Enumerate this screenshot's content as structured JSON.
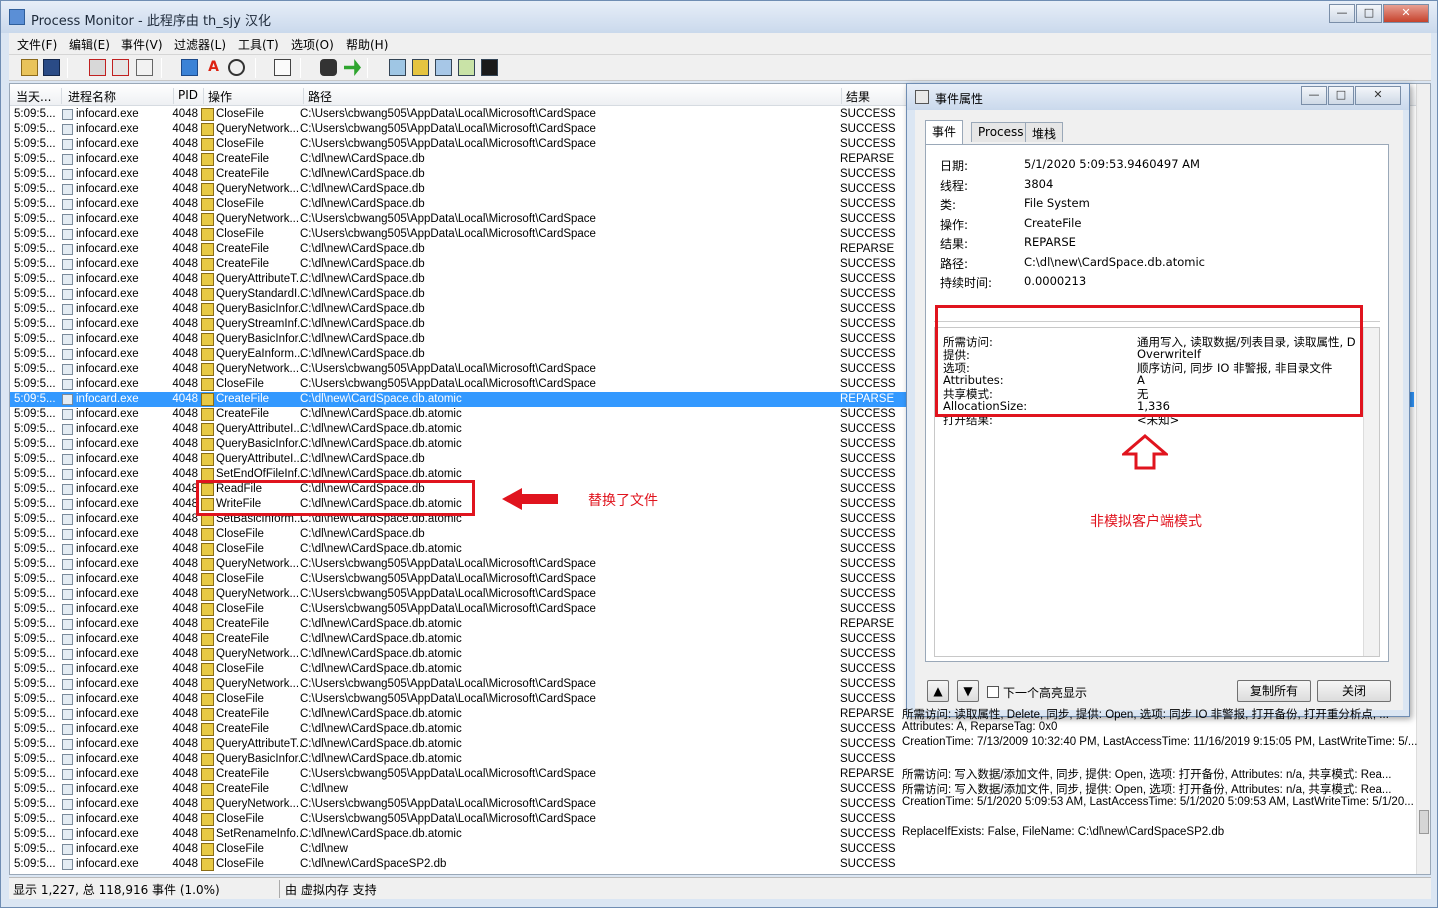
{
  "window": {
    "title": "Process Monitor - 此程序由 th_sjy 汉化",
    "min": "—",
    "max": "□",
    "close": "✕"
  },
  "menu": [
    "文件(F)",
    "编辑(E)",
    "事件(V)",
    "过滤器(L)",
    "工具(T)",
    "选项(O)",
    "帮助(H)"
  ],
  "toolbar_icons": [
    "open-icon",
    "save-icon",
    "capture-icon",
    "autoscroll-icon",
    "clear-icon",
    "filter-icon",
    "highlight-icon",
    "network-icon",
    "properties-icon",
    "find-icon",
    "jump-icon",
    "registry-icon",
    "file-system-icon",
    "network-activity-icon",
    "process-activity-icon",
    "profiling-icon"
  ],
  "columns": [
    "当天...",
    "进程名称",
    "PID",
    "操作",
    "路径",
    "结果"
  ],
  "rows": [
    [
      "5:09:5...",
      "infocard.exe",
      "4048",
      "CloseFile",
      "C:\\Users\\cbwang505\\AppData\\Local\\Microsoft\\CardSpace",
      "SUCCESS"
    ],
    [
      "5:09:5...",
      "infocard.exe",
      "4048",
      "QueryNetwork...",
      "C:\\Users\\cbwang505\\AppData\\Local\\Microsoft\\CardSpace",
      "SUCCESS"
    ],
    [
      "5:09:5...",
      "infocard.exe",
      "4048",
      "CloseFile",
      "C:\\Users\\cbwang505\\AppData\\Local\\Microsoft\\CardSpace",
      "SUCCESS"
    ],
    [
      "5:09:5...",
      "infocard.exe",
      "4048",
      "CreateFile",
      "C:\\dl\\new\\CardSpace.db",
      "REPARSE"
    ],
    [
      "5:09:5...",
      "infocard.exe",
      "4048",
      "CreateFile",
      "C:\\dl\\new\\CardSpace.db",
      "SUCCESS"
    ],
    [
      "5:09:5...",
      "infocard.exe",
      "4048",
      "QueryNetwork...",
      "C:\\dl\\new\\CardSpace.db",
      "SUCCESS"
    ],
    [
      "5:09:5...",
      "infocard.exe",
      "4048",
      "CloseFile",
      "C:\\dl\\new\\CardSpace.db",
      "SUCCESS"
    ],
    [
      "5:09:5...",
      "infocard.exe",
      "4048",
      "QueryNetwork...",
      "C:\\Users\\cbwang505\\AppData\\Local\\Microsoft\\CardSpace",
      "SUCCESS"
    ],
    [
      "5:09:5...",
      "infocard.exe",
      "4048",
      "CloseFile",
      "C:\\Users\\cbwang505\\AppData\\Local\\Microsoft\\CardSpace",
      "SUCCESS"
    ],
    [
      "5:09:5...",
      "infocard.exe",
      "4048",
      "CreateFile",
      "C:\\dl\\new\\CardSpace.db",
      "REPARSE"
    ],
    [
      "5:09:5...",
      "infocard.exe",
      "4048",
      "CreateFile",
      "C:\\dl\\new\\CardSpace.db",
      "SUCCESS"
    ],
    [
      "5:09:5...",
      "infocard.exe",
      "4048",
      "QueryAttributeT...",
      "C:\\dl\\new\\CardSpace.db",
      "SUCCESS"
    ],
    [
      "5:09:5...",
      "infocard.exe",
      "4048",
      "QueryStandardI...",
      "C:\\dl\\new\\CardSpace.db",
      "SUCCESS"
    ],
    [
      "5:09:5...",
      "infocard.exe",
      "4048",
      "QueryBasicInfor...",
      "C:\\dl\\new\\CardSpace.db",
      "SUCCESS"
    ],
    [
      "5:09:5...",
      "infocard.exe",
      "4048",
      "QueryStreamInf...",
      "C:\\dl\\new\\CardSpace.db",
      "SUCCESS"
    ],
    [
      "5:09:5...",
      "infocard.exe",
      "4048",
      "QueryBasicInfor...",
      "C:\\dl\\new\\CardSpace.db",
      "SUCCESS"
    ],
    [
      "5:09:5...",
      "infocard.exe",
      "4048",
      "QueryEaInform...",
      "C:\\dl\\new\\CardSpace.db",
      "SUCCESS"
    ],
    [
      "5:09:5...",
      "infocard.exe",
      "4048",
      "QueryNetwork...",
      "C:\\Users\\cbwang505\\AppData\\Local\\Microsoft\\CardSpace",
      "SUCCESS"
    ],
    [
      "5:09:5...",
      "infocard.exe",
      "4048",
      "CloseFile",
      "C:\\Users\\cbwang505\\AppData\\Local\\Microsoft\\CardSpace",
      "SUCCESS"
    ],
    [
      "5:09:5...",
      "infocard.exe",
      "4048",
      "CreateFile",
      "C:\\dl\\new\\CardSpace.db.atomic",
      "REPARSE"
    ],
    [
      "5:09:5...",
      "infocard.exe",
      "4048",
      "CreateFile",
      "C:\\dl\\new\\CardSpace.db.atomic",
      "SUCCESS"
    ],
    [
      "5:09:5...",
      "infocard.exe",
      "4048",
      "QueryAttributeI...",
      "C:\\dl\\new\\CardSpace.db.atomic",
      "SUCCESS"
    ],
    [
      "5:09:5...",
      "infocard.exe",
      "4048",
      "QueryBasicInfor...",
      "C:\\dl\\new\\CardSpace.db.atomic",
      "SUCCESS"
    ],
    [
      "5:09:5...",
      "infocard.exe",
      "4048",
      "QueryAttributeI...",
      "C:\\dl\\new\\CardSpace.db",
      "SUCCESS"
    ],
    [
      "5:09:5...",
      "infocard.exe",
      "4048",
      "SetEndOfFileInf...",
      "C:\\dl\\new\\CardSpace.db.atomic",
      "SUCCESS"
    ],
    [
      "5:09:5...",
      "infocard.exe",
      "4048",
      "ReadFile",
      "C:\\dl\\new\\CardSpace.db",
      "SUCCESS"
    ],
    [
      "5:09:5...",
      "infocard.exe",
      "4048",
      "WriteFile",
      "C:\\dl\\new\\CardSpace.db.atomic",
      "SUCCESS"
    ],
    [
      "5:09:5...",
      "infocard.exe",
      "4048",
      "SetBasicInform...",
      "C:\\dl\\new\\CardSpace.db.atomic",
      "SUCCESS"
    ],
    [
      "5:09:5...",
      "infocard.exe",
      "4048",
      "CloseFile",
      "C:\\dl\\new\\CardSpace.db",
      "SUCCESS"
    ],
    [
      "5:09:5...",
      "infocard.exe",
      "4048",
      "CloseFile",
      "C:\\dl\\new\\CardSpace.db.atomic",
      "SUCCESS"
    ],
    [
      "5:09:5...",
      "infocard.exe",
      "4048",
      "QueryNetwork...",
      "C:\\Users\\cbwang505\\AppData\\Local\\Microsoft\\CardSpace",
      "SUCCESS"
    ],
    [
      "5:09:5...",
      "infocard.exe",
      "4048",
      "CloseFile",
      "C:\\Users\\cbwang505\\AppData\\Local\\Microsoft\\CardSpace",
      "SUCCESS"
    ],
    [
      "5:09:5...",
      "infocard.exe",
      "4048",
      "QueryNetwork...",
      "C:\\Users\\cbwang505\\AppData\\Local\\Microsoft\\CardSpace",
      "SUCCESS"
    ],
    [
      "5:09:5...",
      "infocard.exe",
      "4048",
      "CloseFile",
      "C:\\Users\\cbwang505\\AppData\\Local\\Microsoft\\CardSpace",
      "SUCCESS"
    ],
    [
      "5:09:5...",
      "infocard.exe",
      "4048",
      "CreateFile",
      "C:\\dl\\new\\CardSpace.db.atomic",
      "REPARSE"
    ],
    [
      "5:09:5...",
      "infocard.exe",
      "4048",
      "CreateFile",
      "C:\\dl\\new\\CardSpace.db.atomic",
      "SUCCESS"
    ],
    [
      "5:09:5...",
      "infocard.exe",
      "4048",
      "QueryNetwork...",
      "C:\\dl\\new\\CardSpace.db.atomic",
      "SUCCESS"
    ],
    [
      "5:09:5...",
      "infocard.exe",
      "4048",
      "CloseFile",
      "C:\\dl\\new\\CardSpace.db.atomic",
      "SUCCESS"
    ],
    [
      "5:09:5...",
      "infocard.exe",
      "4048",
      "QueryNetwork...",
      "C:\\Users\\cbwang505\\AppData\\Local\\Microsoft\\CardSpace",
      "SUCCESS"
    ],
    [
      "5:09:5...",
      "infocard.exe",
      "4048",
      "CloseFile",
      "C:\\Users\\cbwang505\\AppData\\Local\\Microsoft\\CardSpace",
      "SUCCESS"
    ],
    [
      "5:09:5...",
      "infocard.exe",
      "4048",
      "CreateFile",
      "C:\\dl\\new\\CardSpace.db.atomic",
      "REPARSE"
    ],
    [
      "5:09:5...",
      "infocard.exe",
      "4048",
      "CreateFile",
      "C:\\dl\\new\\CardSpace.db.atomic",
      "SUCCESS"
    ],
    [
      "5:09:5...",
      "infocard.exe",
      "4048",
      "QueryAttributeT...",
      "C:\\dl\\new\\CardSpace.db.atomic",
      "SUCCESS"
    ],
    [
      "5:09:5...",
      "infocard.exe",
      "4048",
      "QueryBasicInfor...",
      "C:\\dl\\new\\CardSpace.db.atomic",
      "SUCCESS"
    ],
    [
      "5:09:5...",
      "infocard.exe",
      "4048",
      "CreateFile",
      "C:\\Users\\cbwang505\\AppData\\Local\\Microsoft\\CardSpace",
      "REPARSE"
    ],
    [
      "5:09:5...",
      "infocard.exe",
      "4048",
      "CreateFile",
      "C:\\dl\\new",
      "SUCCESS"
    ],
    [
      "5:09:5...",
      "infocard.exe",
      "4048",
      "QueryNetwork...",
      "C:\\Users\\cbwang505\\AppData\\Local\\Microsoft\\CardSpace",
      "SUCCESS"
    ],
    [
      "5:09:5...",
      "infocard.exe",
      "4048",
      "CloseFile",
      "C:\\Users\\cbwang505\\AppData\\Local\\Microsoft\\CardSpace",
      "SUCCESS"
    ],
    [
      "5:09:5...",
      "infocard.exe",
      "4048",
      "SetRenameInfo...",
      "C:\\dl\\new\\CardSpace.db.atomic",
      "SUCCESS"
    ],
    [
      "5:09:5...",
      "infocard.exe",
      "4048",
      "CloseFile",
      "C:\\dl\\new",
      "SUCCESS"
    ],
    [
      "5:09:5...",
      "infocard.exe",
      "4048",
      "CloseFile",
      "C:\\dl\\new\\CardSpaceSP2.db",
      "SUCCESS"
    ]
  ],
  "selected_row": 19,
  "overflow_details": [
    {
      "row": 40,
      "text": "所需访问: 读取属性, Delete, 同步, 提供: Open, 选项: 同步 IO 非警报, 打开备份, 打开重分析点, ..."
    },
    {
      "row": 41,
      "text": "Attributes: A, ReparseTag: 0x0"
    },
    {
      "row": 42,
      "text": "CreationTime: 7/13/2009 10:32:40 PM, LastAccessTime: 11/16/2019 9:15:05 PM, LastWriteTime: 5/..."
    },
    {
      "row": 44,
      "text": "所需访问: 写入数据/添加文件, 同步, 提供: Open, 选项: 打开备份, Attributes: n/a, 共享模式: Rea..."
    },
    {
      "row": 45,
      "text": "所需访问: 写入数据/添加文件, 同步, 提供: Open, 选项: 打开备份, Attributes: n/a, 共享模式: Rea..."
    },
    {
      "row": 46,
      "text": "CreationTime: 5/1/2020 5:09:53 AM, LastAccessTime: 5/1/2020 5:09:53 AM, LastWriteTime: 5/1/20..."
    },
    {
      "row": 48,
      "text": "ReplaceIfExists: False, FileName: C:\\dl\\new\\CardSpaceSP2.db"
    }
  ],
  "annotations": {
    "replaced": "替换了文件",
    "non_impersonation": "非模拟客户端模式"
  },
  "status": {
    "left": "显示 1,227, 总 118,916 事件 (1.0%)",
    "right": "由 虚拟内存 支持"
  },
  "dialog": {
    "title": "事件属性",
    "tabs": [
      "事件",
      "Process",
      "堆栈"
    ],
    "fields": [
      {
        "label": "日期:",
        "value": "5/1/2020 5:09:53.9460497 AM"
      },
      {
        "label": "线程:",
        "value": "3804"
      },
      {
        "label": "类:",
        "value": "File System"
      },
      {
        "label": "操作:",
        "value": "CreateFile"
      },
      {
        "label": "结果:",
        "value": "REPARSE"
      },
      {
        "label": "路径:",
        "value": "C:\\dl\\new\\CardSpace.db.atomic"
      },
      {
        "label": "持续时间:",
        "value": "0.0000213"
      }
    ],
    "details": [
      {
        "k": "所需访问:",
        "v": "通用写入, 读取数据/列表目录, 读取属性, D"
      },
      {
        "k": "提供:",
        "v": "OverwriteIf"
      },
      {
        "k": "选项:",
        "v": "顺序访问, 同步 IO 非警报, 非目录文件"
      },
      {
        "k": "Attributes:",
        "v": "A"
      },
      {
        "k": "共享模式:",
        "v": "无"
      },
      {
        "k": "AllocationSize:",
        "v": "1,336"
      },
      {
        "k": "打开结果:",
        "v": "<未知>"
      }
    ],
    "next_highlight": "下一个高亮显示",
    "copy_all": "复制所有",
    "close": "关闭"
  }
}
